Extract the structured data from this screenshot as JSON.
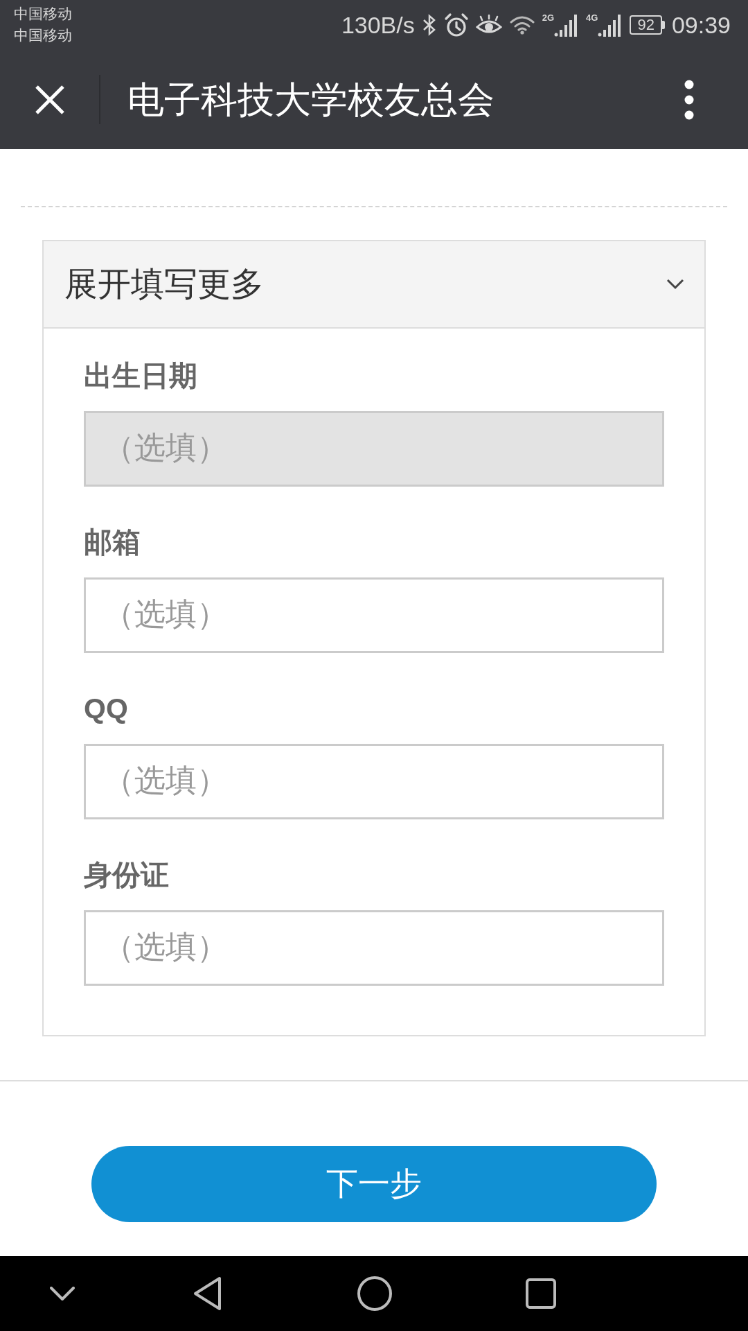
{
  "status_bar": {
    "carriers": [
      "中国移动",
      "中国移动"
    ],
    "net_speed": "130B/s",
    "networks": [
      {
        "label": "2G"
      },
      {
        "label": "4G"
      }
    ],
    "battery": "92",
    "time": "09:39"
  },
  "header": {
    "title": "电子科技大学校友总会"
  },
  "section": {
    "title": "展开填写更多",
    "expanded": true,
    "fields": [
      {
        "label": "出生日期",
        "placeholder": "（选填）",
        "disabled": true
      },
      {
        "label": "邮箱",
        "placeholder": "（选填）",
        "disabled": false
      },
      {
        "label": "QQ",
        "placeholder": "（选填）",
        "disabled": false
      },
      {
        "label": "身份证",
        "placeholder": "（选填）",
        "disabled": false
      }
    ]
  },
  "next_button": {
    "label": "下一步"
  }
}
